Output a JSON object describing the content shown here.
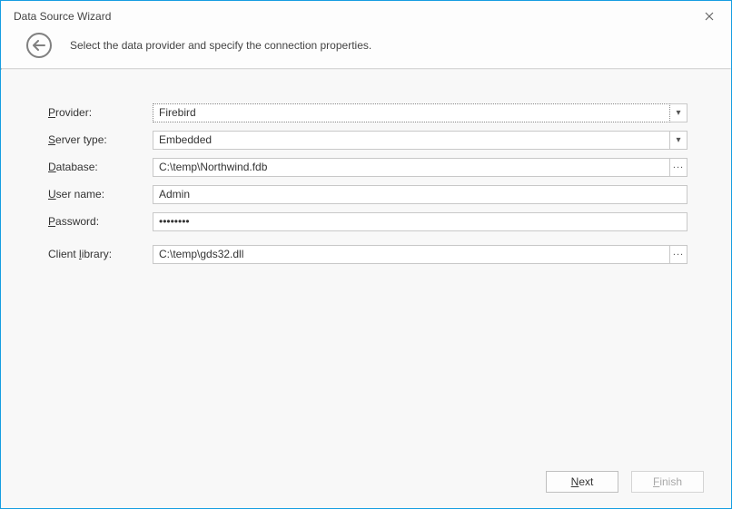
{
  "window": {
    "title": "Data Source Wizard",
    "instruction": "Select the data provider and specify the connection properties."
  },
  "labels": {
    "provider": "rovider:",
    "provider_u": "P",
    "server_type": "erver type:",
    "server_type_u": "S",
    "database": "atabase:",
    "database_u": "D",
    "user_name": "ser name:",
    "user_name_u": "U",
    "password": "assword:",
    "password_u": "P",
    "client_library": "ibrary:",
    "client_library_prefix": "Client ",
    "client_library_u": "l"
  },
  "values": {
    "provider": "Firebird",
    "server_type": "Embedded",
    "database": "C:\\temp\\Northwind.fdb",
    "user_name": "Admin",
    "password": "••••••••",
    "client_library": "C:\\temp\\gds32.dll"
  },
  "buttons": {
    "next": "ext",
    "next_u": "N",
    "finish": "inish",
    "finish_u": "F"
  },
  "icons": {
    "dropdown": "▾",
    "ellipsis": "..."
  }
}
